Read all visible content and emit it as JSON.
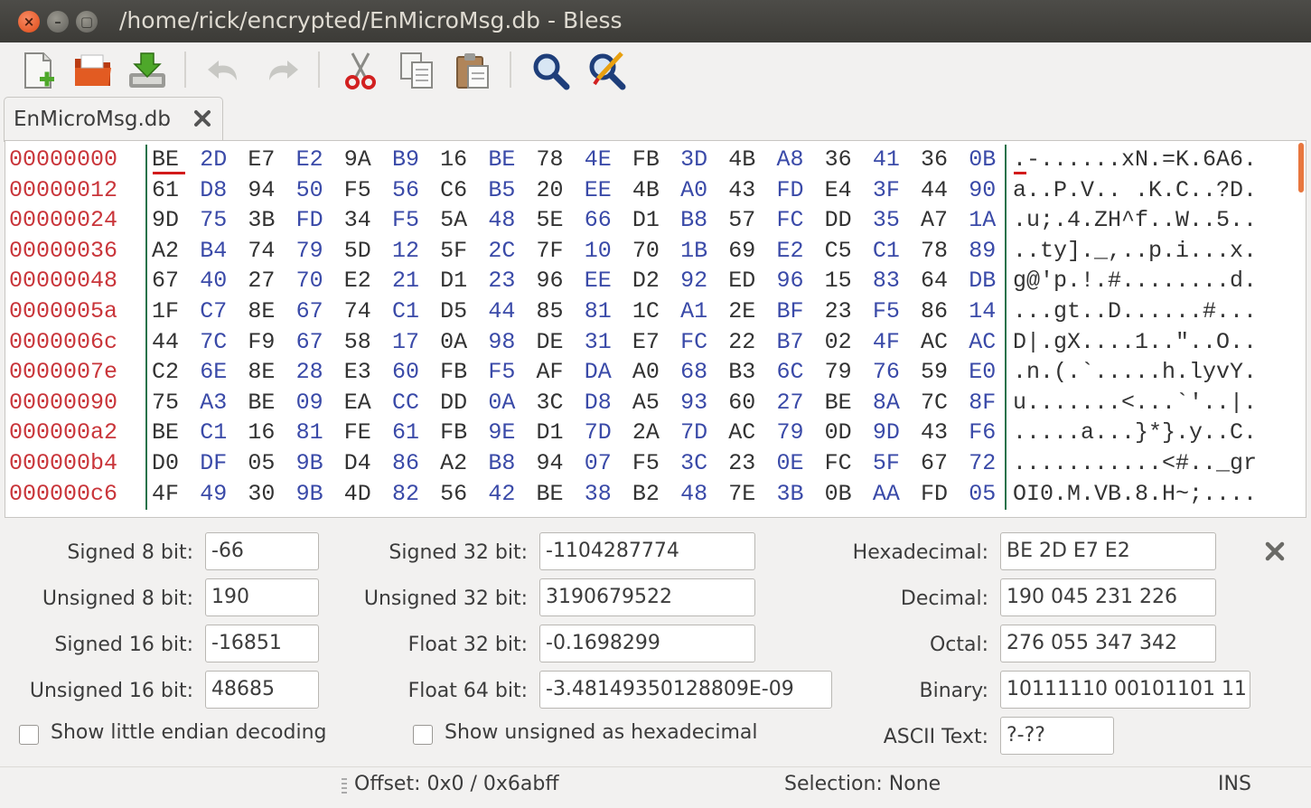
{
  "window": {
    "title": "/home/rick/encrypted/EnMicroMsg.db - Bless"
  },
  "tab": {
    "label": "EnMicroMsg.db"
  },
  "hex": {
    "rows": [
      {
        "offset": "00000000",
        "bytes": [
          "BE",
          "2D",
          "E7",
          "E2",
          "9A",
          "B9",
          "16",
          "BE",
          "78",
          "4E",
          "FB",
          "3D",
          "4B",
          "A8",
          "36",
          "41",
          "36",
          "0B"
        ],
        "ascii": ".-......xN.=K.6A6."
      },
      {
        "offset": "00000012",
        "bytes": [
          "61",
          "D8",
          "94",
          "50",
          "F5",
          "56",
          "C6",
          "B5",
          "20",
          "EE",
          "4B",
          "A0",
          "43",
          "FD",
          "E4",
          "3F",
          "44",
          "90"
        ],
        "ascii": "a..P.V.. .K.C..?D."
      },
      {
        "offset": "00000024",
        "bytes": [
          "9D",
          "75",
          "3B",
          "FD",
          "34",
          "F5",
          "5A",
          "48",
          "5E",
          "66",
          "D1",
          "B8",
          "57",
          "FC",
          "DD",
          "35",
          "A7",
          "1A"
        ],
        "ascii": ".u;.4.ZH^f..W..5.."
      },
      {
        "offset": "00000036",
        "bytes": [
          "A2",
          "B4",
          "74",
          "79",
          "5D",
          "12",
          "5F",
          "2C",
          "7F",
          "10",
          "70",
          "1B",
          "69",
          "E2",
          "C5",
          "C1",
          "78",
          "89"
        ],
        "ascii": "..ty]._,..p.i...x."
      },
      {
        "offset": "00000048",
        "bytes": [
          "67",
          "40",
          "27",
          "70",
          "E2",
          "21",
          "D1",
          "23",
          "96",
          "EE",
          "D2",
          "92",
          "ED",
          "96",
          "15",
          "83",
          "64",
          "DB"
        ],
        "ascii": "g@'p.!.#........d."
      },
      {
        "offset": "0000005a",
        "bytes": [
          "1F",
          "C7",
          "8E",
          "67",
          "74",
          "C1",
          "D5",
          "44",
          "85",
          "81",
          "1C",
          "A1",
          "2E",
          "BF",
          "23",
          "F5",
          "86",
          "14"
        ],
        "ascii": "...gt..D......#..."
      },
      {
        "offset": "0000006c",
        "bytes": [
          "44",
          "7C",
          "F9",
          "67",
          "58",
          "17",
          "0A",
          "98",
          "DE",
          "31",
          "E7",
          "FC",
          "22",
          "B7",
          "02",
          "4F",
          "AC",
          "AC"
        ],
        "ascii": "D|.gX....1..\"..O.."
      },
      {
        "offset": "0000007e",
        "bytes": [
          "C2",
          "6E",
          "8E",
          "28",
          "E3",
          "60",
          "FB",
          "F5",
          "AF",
          "DA",
          "A0",
          "68",
          "B3",
          "6C",
          "79",
          "76",
          "59",
          "E0"
        ],
        "ascii": ".n.(.`.....h.lyvY."
      },
      {
        "offset": "00000090",
        "bytes": [
          "75",
          "A3",
          "BE",
          "09",
          "EA",
          "CC",
          "DD",
          "0A",
          "3C",
          "D8",
          "A5",
          "93",
          "60",
          "27",
          "BE",
          "8A",
          "7C",
          "8F"
        ],
        "ascii": "u.......<...`'..|."
      },
      {
        "offset": "000000a2",
        "bytes": [
          "BE",
          "C1",
          "16",
          "81",
          "FE",
          "61",
          "FB",
          "9E",
          "D1",
          "7D",
          "2A",
          "7D",
          "AC",
          "79",
          "0D",
          "9D",
          "43",
          "F6"
        ],
        "ascii": ".....a...}*}.y..C."
      },
      {
        "offset": "000000b4",
        "bytes": [
          "D0",
          "DF",
          "05",
          "9B",
          "D4",
          "86",
          "A2",
          "B8",
          "94",
          "07",
          "F5",
          "3C",
          "23",
          "0E",
          "FC",
          "5F",
          "67",
          "72"
        ],
        "ascii": "...........<#.._gr"
      },
      {
        "offset": "000000c6",
        "bytes": [
          "4F",
          "49",
          "30",
          "9B",
          "4D",
          "82",
          "56",
          "42",
          "BE",
          "38",
          "B2",
          "48",
          "7E",
          "3B",
          "0B",
          "AA",
          "FD",
          "05"
        ],
        "ascii": "OI0.M.VB.8.H~;...."
      }
    ]
  },
  "conv": {
    "signed8_label": "Signed 8 bit:",
    "signed8": "-66",
    "unsigned8_label": "Unsigned 8 bit:",
    "unsigned8": "190",
    "signed16_label": "Signed 16 bit:",
    "signed16": "-16851",
    "unsigned16_label": "Unsigned 16 bit:",
    "unsigned16": "48685",
    "signed32_label": "Signed 32 bit:",
    "signed32": "-1104287774",
    "unsigned32_label": "Unsigned 32 bit:",
    "unsigned32": "3190679522",
    "float32_label": "Float 32 bit:",
    "float32": "-0.1698299",
    "float64_label": "Float 64 bit:",
    "float64": "-3.48149350128809E-09",
    "hex_label": "Hexadecimal:",
    "hex": "BE 2D E7 E2",
    "dec_label": "Decimal:",
    "dec": "190 045 231 226",
    "oct_label": "Octal:",
    "oct": "276 055 347 342",
    "bin_label": "Binary:",
    "bin": "10111110 00101101 11",
    "ascii_label": "ASCII Text:",
    "ascii": "?-??",
    "little_endian_label": "Show little endian decoding",
    "unsigned_hex_label": "Show unsigned as hexadecimal"
  },
  "status": {
    "offset": "Offset: 0x0 / 0x6abff",
    "selection": "Selection: None",
    "mode": "INS"
  },
  "colors": {
    "offset": "#c9353a",
    "hex_alt": "#3a4aa8",
    "divider": "#24724a",
    "cursor": "#d21a1a",
    "titlebar": "#3c3b37"
  }
}
